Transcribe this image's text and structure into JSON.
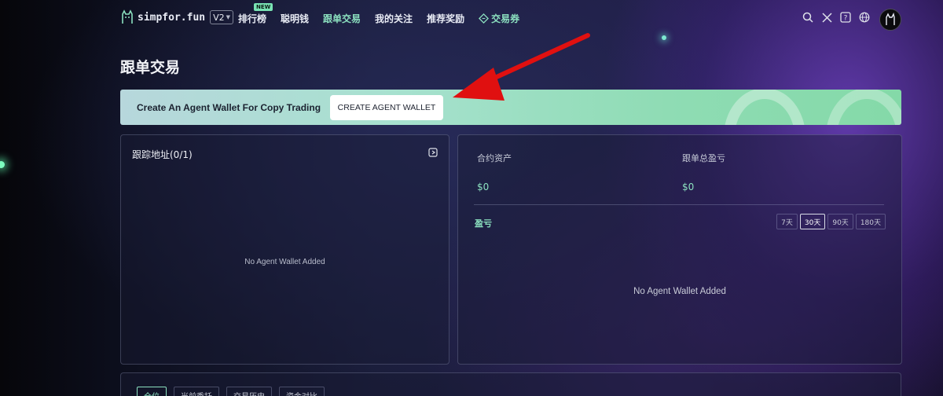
{
  "header": {
    "logo_text": "simpfor.fun",
    "version": "V2",
    "nav": [
      {
        "label": "排行榜",
        "badge": "NEW"
      },
      {
        "label": "聪明钱"
      },
      {
        "label": "跟单交易"
      },
      {
        "label": "我的关注"
      },
      {
        "label": "推荐奖励"
      },
      {
        "label": "交易券"
      }
    ],
    "icons": [
      "search-icon",
      "x-twitter-icon",
      "help-icon",
      "globe-icon"
    ]
  },
  "page": {
    "title": "跟单交易"
  },
  "banner": {
    "text": "Create An Agent Wallet For Copy Trading",
    "button": "CREATE AGENT WALLET"
  },
  "left_panel": {
    "title": "跟踪地址(0/1)",
    "empty": "No Agent Wallet Added"
  },
  "right_panel": {
    "stats": [
      {
        "label": "合约资产",
        "value": "$0"
      },
      {
        "label": "跟单总盈亏",
        "value": "$0"
      }
    ],
    "pnl_title": "盈亏",
    "ranges": [
      "7天",
      "30天",
      "90天",
      "180天"
    ],
    "active_range": "30天",
    "empty": "No Agent Wallet Added"
  },
  "bottom_tabs": [
    "仓位",
    "当前委托",
    "交易历史",
    "资金对比"
  ],
  "colors": {
    "accent": "#8be0bf",
    "annotation_arrow": "#e01010"
  }
}
